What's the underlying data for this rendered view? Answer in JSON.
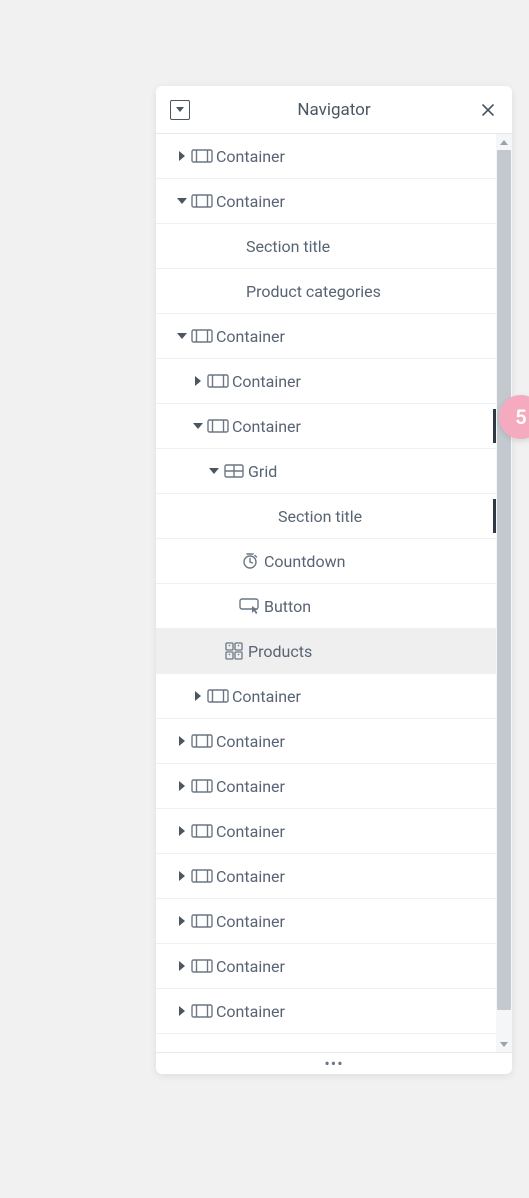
{
  "header": {
    "title": "Navigator"
  },
  "tree": [
    {
      "depth": 0,
      "caret": "right",
      "icon": "container",
      "label": "Container",
      "selected": false,
      "marked": false
    },
    {
      "depth": 0,
      "caret": "down",
      "icon": "container",
      "label": "Container",
      "selected": false,
      "marked": false
    },
    {
      "depth": 1,
      "caret": null,
      "icon": null,
      "label": "Section title",
      "selected": false,
      "marked": false
    },
    {
      "depth": 1,
      "caret": null,
      "icon": null,
      "label": "Product categories",
      "selected": false,
      "marked": false
    },
    {
      "depth": 0,
      "caret": "down",
      "icon": "container",
      "label": "Container",
      "selected": false,
      "marked": false
    },
    {
      "depth": 1,
      "caret": "right",
      "icon": "container",
      "label": "Container",
      "selected": false,
      "marked": false
    },
    {
      "depth": 1,
      "caret": "down",
      "icon": "container",
      "label": "Container",
      "selected": false,
      "marked": true
    },
    {
      "depth": 2,
      "caret": "down",
      "icon": "grid",
      "label": "Grid",
      "selected": false,
      "marked": false
    },
    {
      "depth": 3,
      "caret": null,
      "icon": null,
      "label": "Section title",
      "selected": false,
      "marked": true
    },
    {
      "depth": 3,
      "caret": null,
      "icon": "countdown",
      "label": "Countdown",
      "selected": false,
      "marked": false
    },
    {
      "depth": 3,
      "caret": null,
      "icon": "button",
      "label": "Button",
      "selected": false,
      "marked": false
    },
    {
      "depth": 2,
      "caret": null,
      "icon": "products",
      "label": "Products",
      "selected": true,
      "marked": false
    },
    {
      "depth": 1,
      "caret": "right",
      "icon": "container",
      "label": "Container",
      "selected": false,
      "marked": false
    },
    {
      "depth": 0,
      "caret": "right",
      "icon": "container",
      "label": "Container",
      "selected": false,
      "marked": false
    },
    {
      "depth": 0,
      "caret": "right",
      "icon": "container",
      "label": "Container",
      "selected": false,
      "marked": false
    },
    {
      "depth": 0,
      "caret": "right",
      "icon": "container",
      "label": "Container",
      "selected": false,
      "marked": false
    },
    {
      "depth": 0,
      "caret": "right",
      "icon": "container",
      "label": "Container",
      "selected": false,
      "marked": false
    },
    {
      "depth": 0,
      "caret": "right",
      "icon": "container",
      "label": "Container",
      "selected": false,
      "marked": false
    },
    {
      "depth": 0,
      "caret": "right",
      "icon": "container",
      "label": "Container",
      "selected": false,
      "marked": false
    },
    {
      "depth": 0,
      "caret": "right",
      "icon": "container",
      "label": "Container",
      "selected": false,
      "marked": false
    }
  ],
  "indent": {
    "base": 20,
    "step": 16,
    "labelExtra": 42
  },
  "scrollbar": {
    "thumbTop": 16,
    "thumbHeight": 860
  },
  "badge": {
    "text": "5"
  }
}
